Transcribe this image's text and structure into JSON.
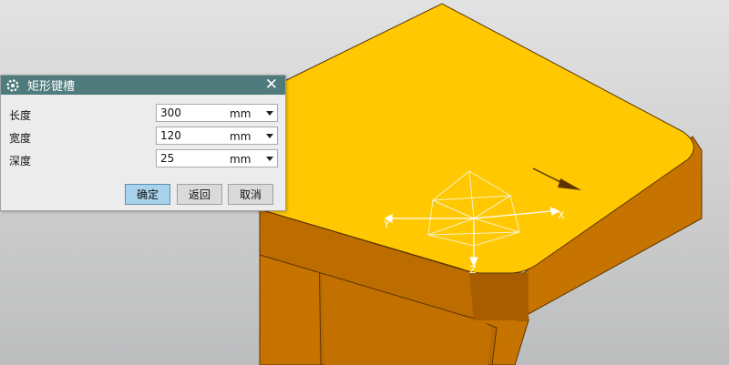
{
  "dialog": {
    "title": "矩形键槽",
    "icon": "gear-icon",
    "close_label": "✕",
    "fields": [
      {
        "label": "长度",
        "value": "300",
        "unit": "mm"
      },
      {
        "label": "宽度",
        "value": "120",
        "unit": "mm"
      },
      {
        "label": "深度",
        "value": "25",
        "unit": "mm"
      }
    ],
    "buttons": {
      "ok": "确定",
      "back": "返回",
      "cancel": "取消"
    }
  },
  "viewport": {
    "axis_x": "X",
    "axis_y": "Y",
    "axis_z": "Z",
    "colors": {
      "top_face": "#ffc800",
      "side_face": "#c77300",
      "side_face_dark": "#a85e00",
      "background_top": "#e2e2e2",
      "background_bottom": "#bcbdbe",
      "dialog_title": "#4f7b7c"
    }
  }
}
